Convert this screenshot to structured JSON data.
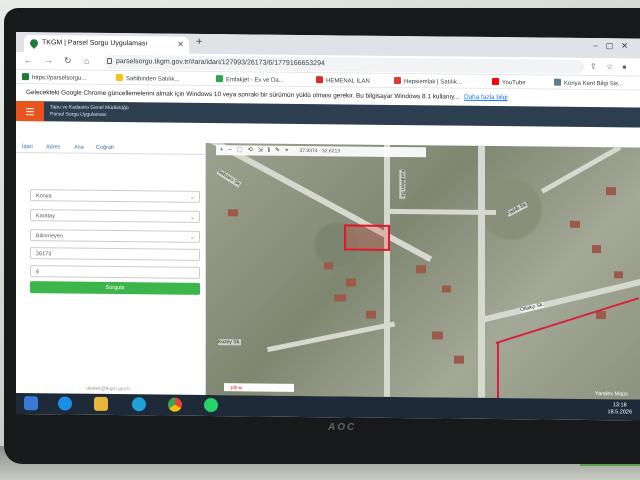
{
  "browser": {
    "tab_title": "TKGM | Parsel Sorgu Uygulaması",
    "new_tab": "+",
    "url": "parselsorgu.tkgm.gov.tr/#ara/idari/127993/26173/6/1779166653294",
    "bookmarks": [
      {
        "label": "https://parselsorgu...",
        "color": "#1e7a34"
      },
      {
        "label": "Sahibinden Satılık...",
        "color": "#f6c21a"
      },
      {
        "label": "Emlakjet - Ev ve Da...",
        "color": "#2fa84f"
      },
      {
        "label": "HEMENAL İLAN",
        "color": "#d93025"
      },
      {
        "label": "Hepsiemlak | Satılık...",
        "color": "#e53935"
      },
      {
        "label": "YouTube",
        "color": "#ff0000"
      },
      {
        "label": "Konya Kent Bilgi Sis...",
        "color": "#607d8b"
      }
    ],
    "banner_text": "Gelecekteki Google Chrome güncellemelerini almak için Windows 10 veya sonraki bir sürümün yüklü olması gerekir. Bu bilgisayar Windows 8.1 kullanıy...",
    "banner_link": "Daha fazla bilgi"
  },
  "site": {
    "org_line1": "Tapu ve Kadastro Genel Müdürlüğü",
    "org_line2": "Parsel Sorgu Uygulaması"
  },
  "panel": {
    "tabs": [
      "İdari",
      "Adres",
      "Ana",
      "Coğrafi"
    ],
    "fields": {
      "il": "Konya",
      "ilce": "Karatay",
      "mahalle": "Bilinmeyen",
      "ada": "26173",
      "parsel": "6"
    },
    "query_button": "Sorgula",
    "footer": "destek@tkgm.gov.tr"
  },
  "map": {
    "toolbar_icons": [
      "+",
      "−",
      "⬚",
      "⟲",
      "⇲",
      "ℹ",
      "✎",
      "⌖"
    ],
    "coordinates": "37.9374 · 32.6213",
    "scale_label": "100 m",
    "attribution": "Yandex Maps",
    "street_labels": [
      "Sebzeci Sk.",
      "Kuzey Sk.",
      "Kardelen Sk.",
      "Fadıllı Sk.",
      "Otlakçı Sk."
    ]
  },
  "taskbar": {
    "time": "13:18",
    "date": "18.5.2026"
  },
  "monitor_brand": "AOC"
}
